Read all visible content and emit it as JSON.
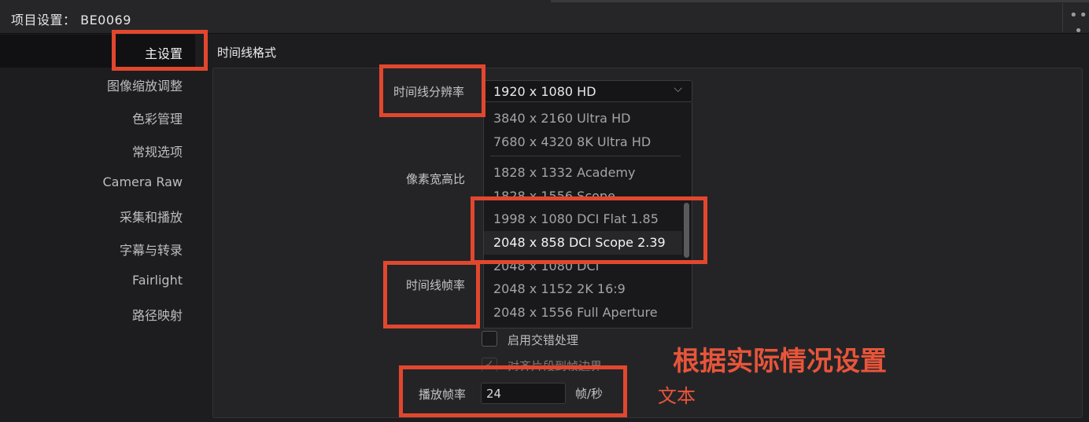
{
  "window": {
    "title": "项目设置：  BE0069",
    "menu_icon": "more-dots-icon"
  },
  "sidebar": {
    "items": [
      {
        "label": "主设置",
        "active": true
      },
      {
        "label": "图像缩放调整"
      },
      {
        "label": "色彩管理"
      },
      {
        "label": "常规选项"
      },
      {
        "label": "Camera Raw"
      },
      {
        "label": "采集和播放"
      },
      {
        "label": "字幕与转录"
      },
      {
        "label": "Fairlight"
      },
      {
        "label": "路径映射"
      }
    ]
  },
  "section": {
    "title": "时间线格式"
  },
  "fields": {
    "resolution_label": "时间线分辨率",
    "resolution_value": "1920 x 1080 HD",
    "pixel_aspect_label": "像素宽高比",
    "frame_rate_label": "时间线帧率",
    "interlace_label": "启用交错处理",
    "interlace_checked": false,
    "mixed_rate_label": "对齐片段到帧边界",
    "playback_fps_label": "播放帧率",
    "playback_fps_value": "24",
    "playback_fps_unit": "帧/秒"
  },
  "dropdown": {
    "options": [
      "3840 x 2160 Ultra HD",
      "7680 x 4320 8K Ultra HD",
      "1828 x 1332 Academy",
      "1828 x 1556 Scope",
      "1998 x 1080 DCI Flat 1.85",
      "2048 x 858 DCI Scope 2.39",
      "2048 x 1080 DCI",
      "2048 x 1152 2K 16:9",
      "2048 x 1556 Full Aperture"
    ],
    "highlighted": "2048 x 858 DCI Scope 2.39"
  },
  "annotations": {
    "main_note": "根据实际情况设置",
    "text_note": "文本",
    "color": "#e2472e"
  }
}
